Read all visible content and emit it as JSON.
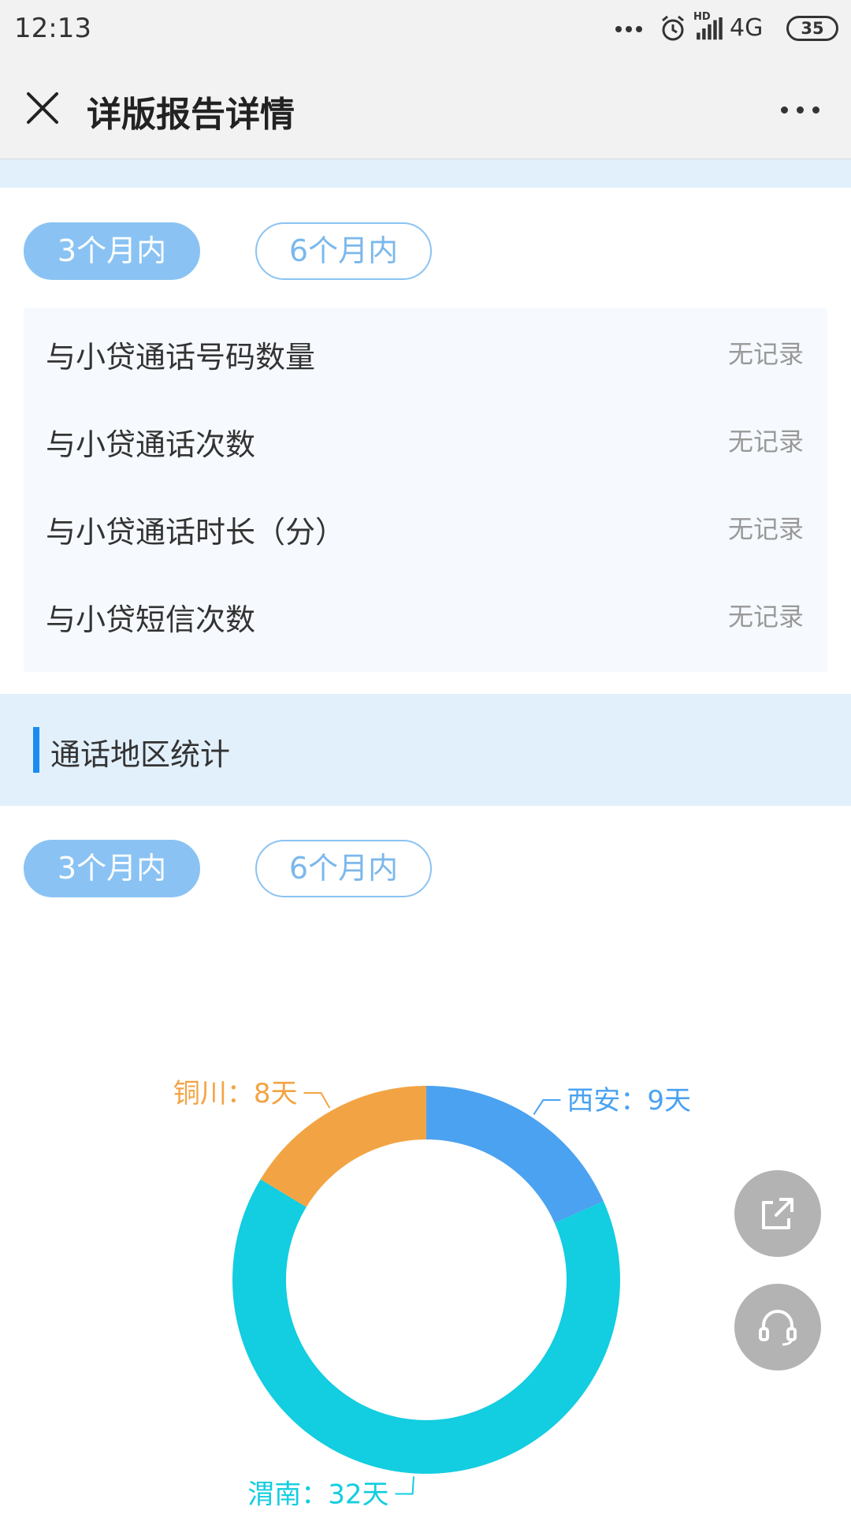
{
  "status_bar": {
    "time": "12:13",
    "hd_label": "HD",
    "network": "4G",
    "battery": "35"
  },
  "nav": {
    "title": "详版报告详情"
  },
  "loan_section": {
    "tabs": [
      {
        "label": "3个月内",
        "active": true
      },
      {
        "label": "6个月内",
        "active": false
      }
    ],
    "rows": [
      {
        "label": "与小贷通话号码数量",
        "value": "无记录"
      },
      {
        "label": "与小贷通话次数",
        "value": "无记录"
      },
      {
        "label": "与小贷通话时长（分）",
        "value": "无记录"
      },
      {
        "label": "与小贷短信次数",
        "value": "无记录"
      }
    ]
  },
  "region_section": {
    "title": "通话地区统计",
    "tabs": [
      {
        "label": "3个月内",
        "active": true
      },
      {
        "label": "6个月内",
        "active": false
      }
    ]
  },
  "chart_data": {
    "type": "pie",
    "donut": true,
    "categories": [
      "西安",
      "渭南",
      "铜川"
    ],
    "values": [
      9,
      32,
      8
    ],
    "unit": "天",
    "labels": [
      "西安：9天",
      "渭南：32天",
      "铜川：8天"
    ],
    "colors": [
      "#4aa2f0",
      "#13cde0",
      "#f2a444"
    ]
  },
  "fabs": {
    "share_icon": "share-icon",
    "service_icon": "headset-icon"
  },
  "colors": {
    "accent": "#1a8cf0",
    "pill_active": "#8ac3f3",
    "band": "#e2f0fc"
  }
}
